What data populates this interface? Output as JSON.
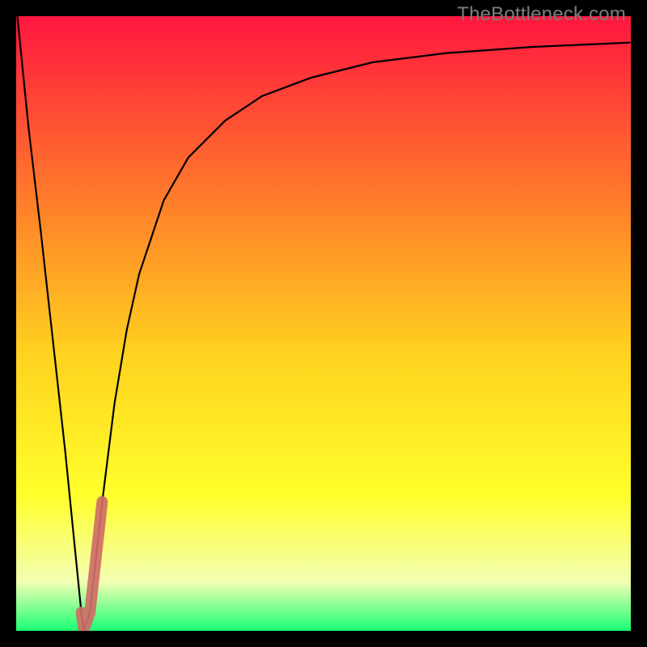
{
  "watermark": "TheBottleneck.com",
  "colors": {
    "background": "#000000",
    "gradient_top": "#ff163f",
    "gradient_mid1": "#ff7d2a",
    "gradient_mid2": "#ffd21f",
    "gradient_mid3": "#ffff2b",
    "gradient_mid4": "#f3ffb3",
    "gradient_bottom": "#19ff74",
    "curve": "#000000",
    "highlight_segment": "#cf6e67"
  },
  "chart_data": {
    "type": "line",
    "title": "",
    "xlabel": "",
    "ylabel": "",
    "xlim": [
      0,
      100
    ],
    "ylim": [
      0,
      100
    ],
    "series": [
      {
        "name": "bottleneck-curve",
        "x": [
          0.2,
          2,
          4,
          6,
          8,
          9.5,
          10.6,
          11,
          12,
          13,
          14,
          16,
          18,
          20,
          24,
          28,
          34,
          40,
          48,
          58,
          70,
          84,
          99.8
        ],
        "y": [
          99.9,
          82,
          65,
          47,
          29,
          14,
          3,
          0.2,
          3,
          12,
          21,
          37,
          49,
          58,
          70,
          77,
          83,
          87,
          90,
          92.5,
          94,
          95,
          95.7
        ]
      }
    ],
    "highlight_segment": {
      "name": "bottleneck-highlight",
      "x": [
        10.6,
        11,
        12,
        13,
        14
      ],
      "y": [
        3,
        0.2,
        3,
        12,
        21
      ]
    }
  }
}
